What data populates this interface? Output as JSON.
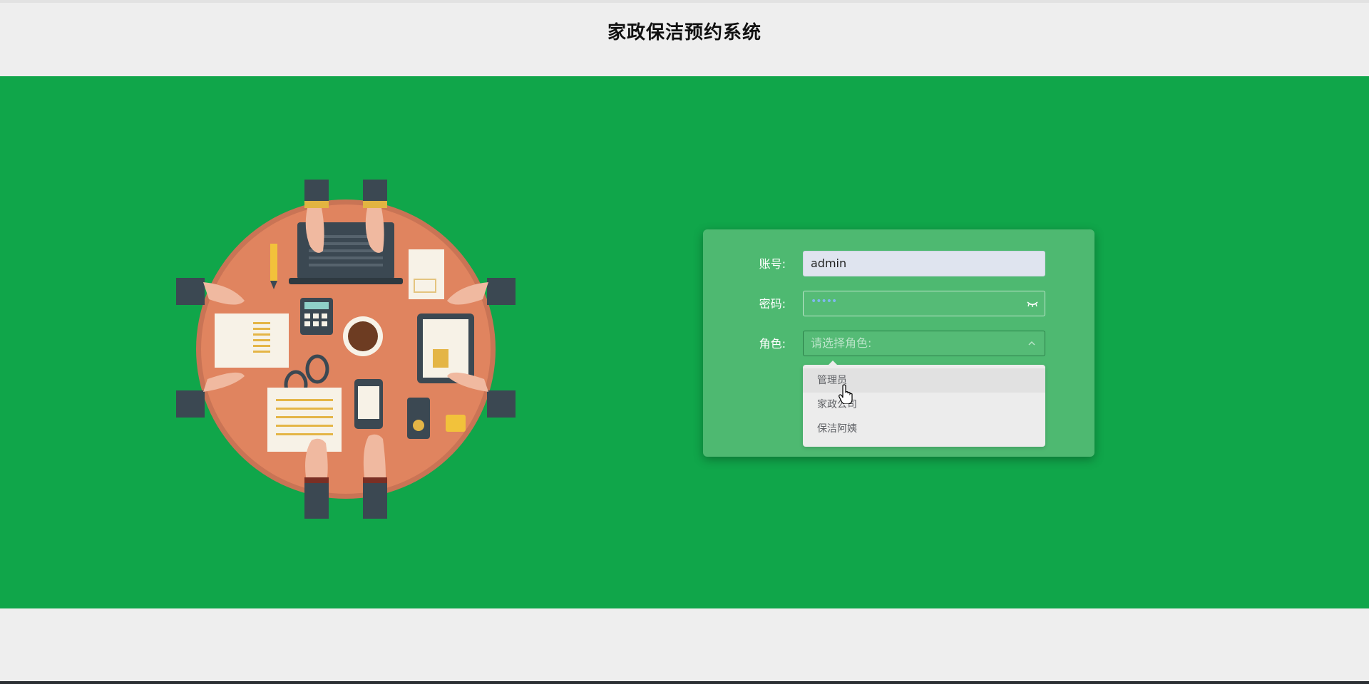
{
  "header": {
    "title": "家政保洁预约系统"
  },
  "login": {
    "account_label": "账号:",
    "account_value": "admin",
    "password_label": "密码:",
    "password_value": "•••••",
    "role_label": "角色:",
    "role_placeholder": "请选择角色:",
    "role_options": [
      "管理员",
      "家政公司",
      "保洁阿姨"
    ],
    "hovered_option": "管理员"
  },
  "colors": {
    "background_green": "#10a64a",
    "card_green": "#4eb971",
    "header_gray": "#eeeeee"
  },
  "icons": [
    "eye-closed-icon",
    "chevron-up-icon",
    "hand-cursor-icon"
  ]
}
